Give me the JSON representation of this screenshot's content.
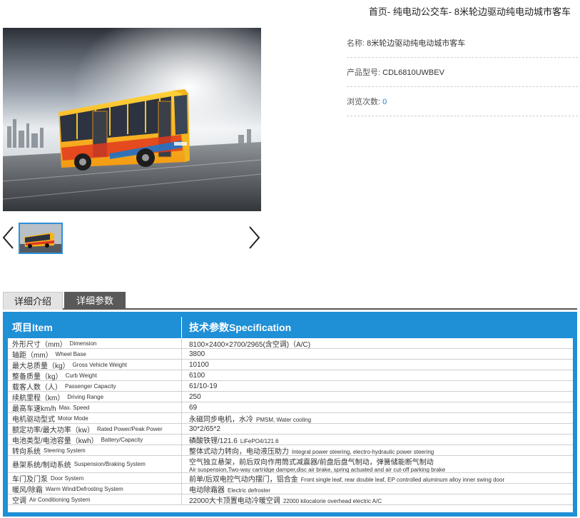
{
  "breadcrumb": "首页- 纯电动公交车- 8米轮边驱动纯电动城市客车",
  "gallery": {
    "main_image": "electric-city-bus-photo",
    "thumbnail": "electric-city-bus-thumbnail",
    "prev_icon": "chevron-left-icon",
    "next_icon": "chevron-right-icon"
  },
  "info": {
    "name_label": "名称:",
    "name_value": "8米轮边驱动纯电动城市客车",
    "model_label": "产品型号:",
    "model_value": "CDL6810UWBEV",
    "views_label": "浏览次数:",
    "views_value": "0"
  },
  "tabs": [
    "详细介绍",
    "详细参数"
  ],
  "spec": {
    "header_item": "项目Item",
    "header_spec": "技术参数Specification",
    "rows": [
      {
        "cn": "外形尺寸（mm）",
        "en": "Dimension",
        "val": "8100×2400×2700/2965(含空调)（A/C)",
        "val_en": "",
        "sub": ""
      },
      {
        "cn": "轴距（mm）",
        "en": "Wheel Base",
        "val": "3800",
        "val_en": "",
        "sub": ""
      },
      {
        "cn": "最大总质量（kg）",
        "en": "Gross Vehicle Weight",
        "val": "10100",
        "val_en": "",
        "sub": ""
      },
      {
        "cn": "整备质量（kg）",
        "en": "Curb Weight",
        "val": "6100",
        "val_en": "",
        "sub": ""
      },
      {
        "cn": "载客人数（人）",
        "en": "Passenger Capacity",
        "val": "61/10-19",
        "val_en": "",
        "sub": ""
      },
      {
        "cn": "续航里程（km）",
        "en": "Driving Range",
        "val": "250",
        "val_en": "",
        "sub": ""
      },
      {
        "cn": "最高车速km/h",
        "en": "Max. Speed",
        "val": "69",
        "val_en": "",
        "sub": ""
      },
      {
        "cn": "电机驱动型式",
        "en": "Motor Mode",
        "val": "永磁同步电机，水冷",
        "val_en": "PMSM, Water cooling",
        "sub": ""
      },
      {
        "cn": "额定功率/最大功率（kw）",
        "en": "Rated Power/Peak Power",
        "val": "30*2/65*2",
        "val_en": "",
        "sub": ""
      },
      {
        "cn": "电池类型/电池容量（kwh）",
        "en": "Battery/Capacity",
        "val": "磷酸铁锂/121.6",
        "val_en": "LiFePO4/121.6",
        "sub": ""
      },
      {
        "cn": "转向系统",
        "en": "Steering System",
        "val": "整体式动力转向，电动液压助力",
        "val_en": "Integral power steering, electro-hydraulic power steering",
        "sub": ""
      },
      {
        "cn": "悬架系统/制动系统",
        "en": "Suspension/Braking System",
        "val": "空气独立悬架，前后双向作用筒式减震器/前盘后盘气制动，弹簧储能断气制动",
        "val_en": "",
        "sub": "Air suspension,Two-way cartridge damper,disc air brake, spring actuated and air cut-off parking brake"
      },
      {
        "cn": "车门及门泵",
        "en": "Door System",
        "val": "前单/后双电控气动内摆门，铝合金",
        "val_en": "Front single leaf, rear double leaf, EP controlled aluminum alloy inner swing door",
        "sub": ""
      },
      {
        "cn": "暖风/除霜",
        "en": "Warm Wind/Defrosting System",
        "val": "电动除霜器",
        "val_en": "Electric defroster",
        "sub": ""
      },
      {
        "cn": "空调",
        "en": "Air Conditioning System",
        "val": "22000大卡顶置电动冷暖空调",
        "val_en": "22000 kilocalorie  overhead electric A/C",
        "sub": ""
      }
    ]
  }
}
